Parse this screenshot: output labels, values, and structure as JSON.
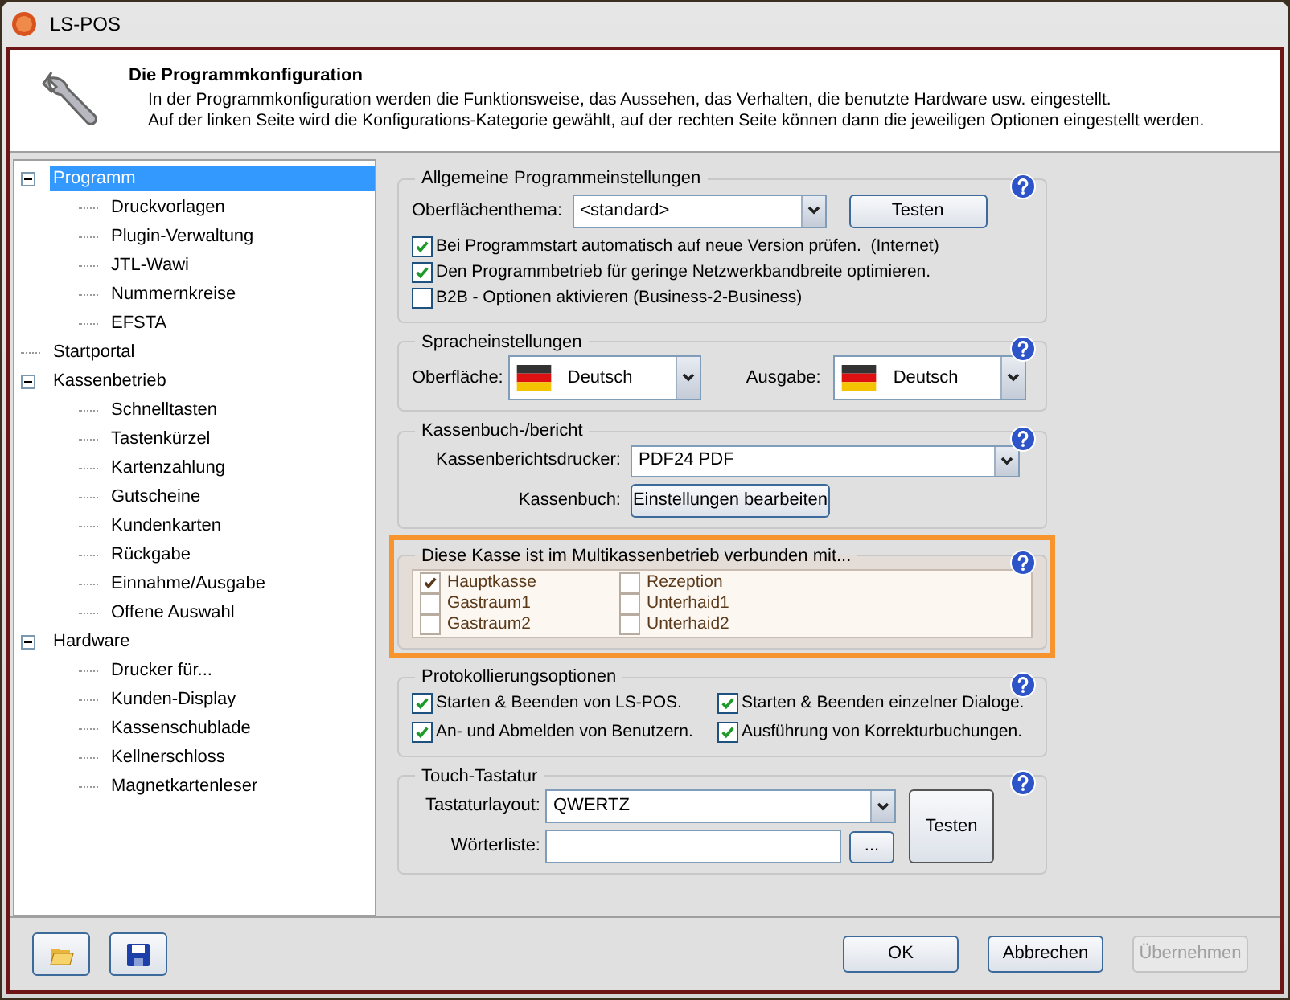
{
  "window": {
    "title": "LS-POS"
  },
  "header": {
    "title": "Die Programmkonfiguration",
    "lines": [
      "In der Programmkonfiguration werden die Funktionsweise, das Aussehen, das Verhalten, die benutzte Hardware usw. eingestellt.",
      "Auf der linken Seite wird die Konfigurations-Kategorie gewählt, auf der rechten Seite können dann die jeweiligen Optionen eingestellt werden."
    ]
  },
  "tree": [
    {
      "label": "Programm",
      "selected": true,
      "expanded": true,
      "children": [
        {
          "label": "Druckvorlagen",
          "selected": false
        },
        {
          "label": "Plugin-Verwaltung",
          "selected": false
        },
        {
          "label": "JTL-Wawi",
          "selected": false
        },
        {
          "label": "Nummernkreise",
          "selected": false
        },
        {
          "label": "EFSTA",
          "selected": false
        }
      ]
    },
    {
      "label": "Startportal",
      "selected": false
    },
    {
      "label": "Kassenbetrieb",
      "selected": false,
      "expanded": true,
      "children": [
        {
          "label": "Schnelltasten",
          "selected": false
        },
        {
          "label": "Tastenkürzel",
          "selected": false
        },
        {
          "label": "Kartenzahlung",
          "selected": false
        },
        {
          "label": "Gutscheine",
          "selected": false
        },
        {
          "label": "Kundenkarten",
          "selected": false
        },
        {
          "label": "Rückgabe",
          "selected": false
        },
        {
          "label": "Einnahme/Ausgabe",
          "selected": false
        },
        {
          "label": "Offene Auswahl",
          "selected": false
        }
      ]
    },
    {
      "label": "Hardware",
      "selected": false,
      "expanded": true,
      "children": [
        {
          "label": "Drucker für...",
          "selected": false
        },
        {
          "label": "Kunden-Display",
          "selected": false
        },
        {
          "label": "Kassenschublade",
          "selected": false
        },
        {
          "label": "Kellnerschloss",
          "selected": false
        },
        {
          "label": "Magnetkartenleser",
          "selected": false
        }
      ]
    }
  ],
  "general": {
    "title": "Allgemeine Programmeinstellungen",
    "theme_label": "Oberflächenthema:",
    "theme_value": "<standard>",
    "test_button": "Testen",
    "options": [
      {
        "label": "Bei Programmstart automatisch auf neue Version prüfen.  (Internet)",
        "checked": true
      },
      {
        "label": "Den Programmbetrieb für geringe Netzwerkbandbreite optimieren.",
        "checked": true
      },
      {
        "label": "B2B - Optionen aktivieren (Business-2-Business)",
        "checked": false
      }
    ]
  },
  "language": {
    "title": "Spracheinstellungen",
    "ui_label": "Oberfläche:",
    "ui_value": "Deutsch",
    "output_label": "Ausgabe:",
    "output_value": "Deutsch"
  },
  "cashbook": {
    "title": "Kassenbuch-/bericht",
    "printer_label": "Kassenberichtsdrucker:",
    "printer_value": "PDF24 PDF",
    "book_label": "Kassenbuch:",
    "book_button": "Einstellungen bearbeiten"
  },
  "multi": {
    "title": "Diese Kasse ist im Multikassenbetrieb verbunden mit...",
    "highlighted": true,
    "registers": [
      {
        "label": "Hauptkasse",
        "checked": true
      },
      {
        "label": "Rezeption",
        "checked": false
      },
      {
        "label": "Gastraum1",
        "checked": false
      },
      {
        "label": "Unterhaid1",
        "checked": false
      },
      {
        "label": "Gastraum2",
        "checked": false
      },
      {
        "label": "Unterhaid2",
        "checked": false
      }
    ]
  },
  "logging": {
    "title": "Protokollierungsoptionen",
    "options": [
      {
        "label": "Starten & Beenden von LS-POS.",
        "checked": true
      },
      {
        "label": "Starten & Beenden einzelner Dialoge.",
        "checked": true
      },
      {
        "label": "An- und Abmelden von Benutzern.",
        "checked": true
      },
      {
        "label": "Ausführung von Korrekturbuchungen.",
        "checked": true
      }
    ]
  },
  "touch": {
    "title": "Touch-Tastatur",
    "layout_label": "Tastaturlayout:",
    "layout_value": "QWERTZ",
    "words_label": "Wörterliste:",
    "browse_button": "...",
    "test_button": "Testen"
  },
  "footer": {
    "buttons": [
      {
        "label": "OK",
        "disabled": false
      },
      {
        "label": "Abbrechen",
        "disabled": false
      },
      {
        "label": "Übernehmen",
        "disabled": true
      }
    ]
  }
}
